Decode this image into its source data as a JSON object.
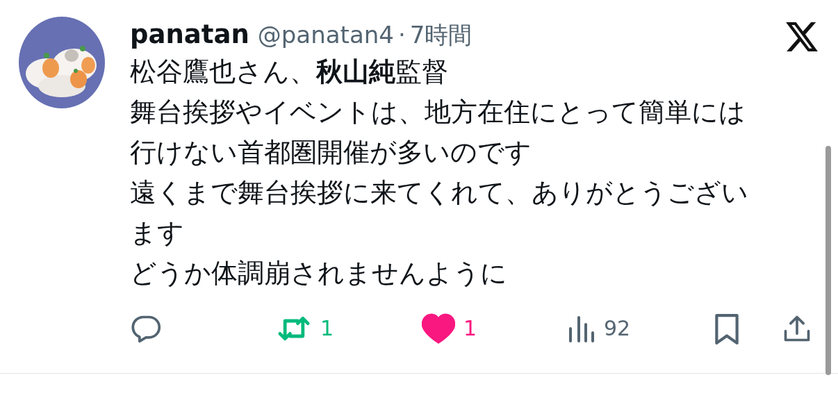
{
  "tweet": {
    "display_name": "panatan",
    "handle": "@panatan4",
    "separator": "·",
    "time": "7時間",
    "lines": [
      "松谷鷹也さん、**秋山純**監督",
      "舞台挨拶やイベントは、地方在住にとって簡単には",
      "行けない首都圏開催が多いのです",
      "遠くまで舞台挨拶に来てくれて、ありがとうござい",
      "ます",
      "どうか体調崩されませんように"
    ],
    "actions": [
      {
        "kind": "reply"
      },
      {
        "kind": "retweet",
        "count": "1",
        "selected": true
      },
      {
        "kind": "like",
        "count": "1",
        "selected": true
      },
      {
        "kind": "views",
        "count": "92"
      },
      {
        "kind": "bookmark"
      },
      {
        "kind": "share"
      }
    ]
  }
}
